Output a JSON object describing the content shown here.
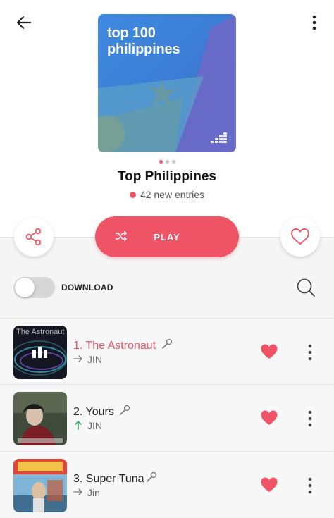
{
  "header": {
    "back_icon": "arrow-left-icon",
    "more_icon": "more-vertical-icon"
  },
  "cover": {
    "line1": "top 100",
    "line2": "philippines",
    "logo_icon": "deezer-logo-icon"
  },
  "carousel": {
    "count": 3,
    "active": 0
  },
  "playlist": {
    "title": "Top Philippines",
    "new_entries": "42 new entries"
  },
  "actions": {
    "share_icon": "share-icon",
    "play_label": "PLAY",
    "shuffle_icon": "shuffle-icon",
    "favorite_icon": "heart-outline-icon"
  },
  "download": {
    "label": "DOWNLOAD",
    "enabled": false,
    "search_icon": "search-icon"
  },
  "tracks": [
    {
      "title": "1. The Astronaut",
      "artist": "JIN",
      "trend": "same",
      "playing": true,
      "favorited": true,
      "art_text": "The Astronaut"
    },
    {
      "title": "2. Yours",
      "artist": "JIN",
      "trend": "up",
      "playing": false,
      "favorited": true,
      "art_text": ""
    },
    {
      "title": "3. Super Tuna",
      "artist": "Jin",
      "trend": "same",
      "playing": false,
      "favorited": true,
      "art_text": ""
    }
  ],
  "colors": {
    "accent": "#ef5466",
    "trend_up": "#2eaa5c",
    "cover_blue": "#3a7bd5",
    "cover_purple": "#6a6fc4"
  }
}
